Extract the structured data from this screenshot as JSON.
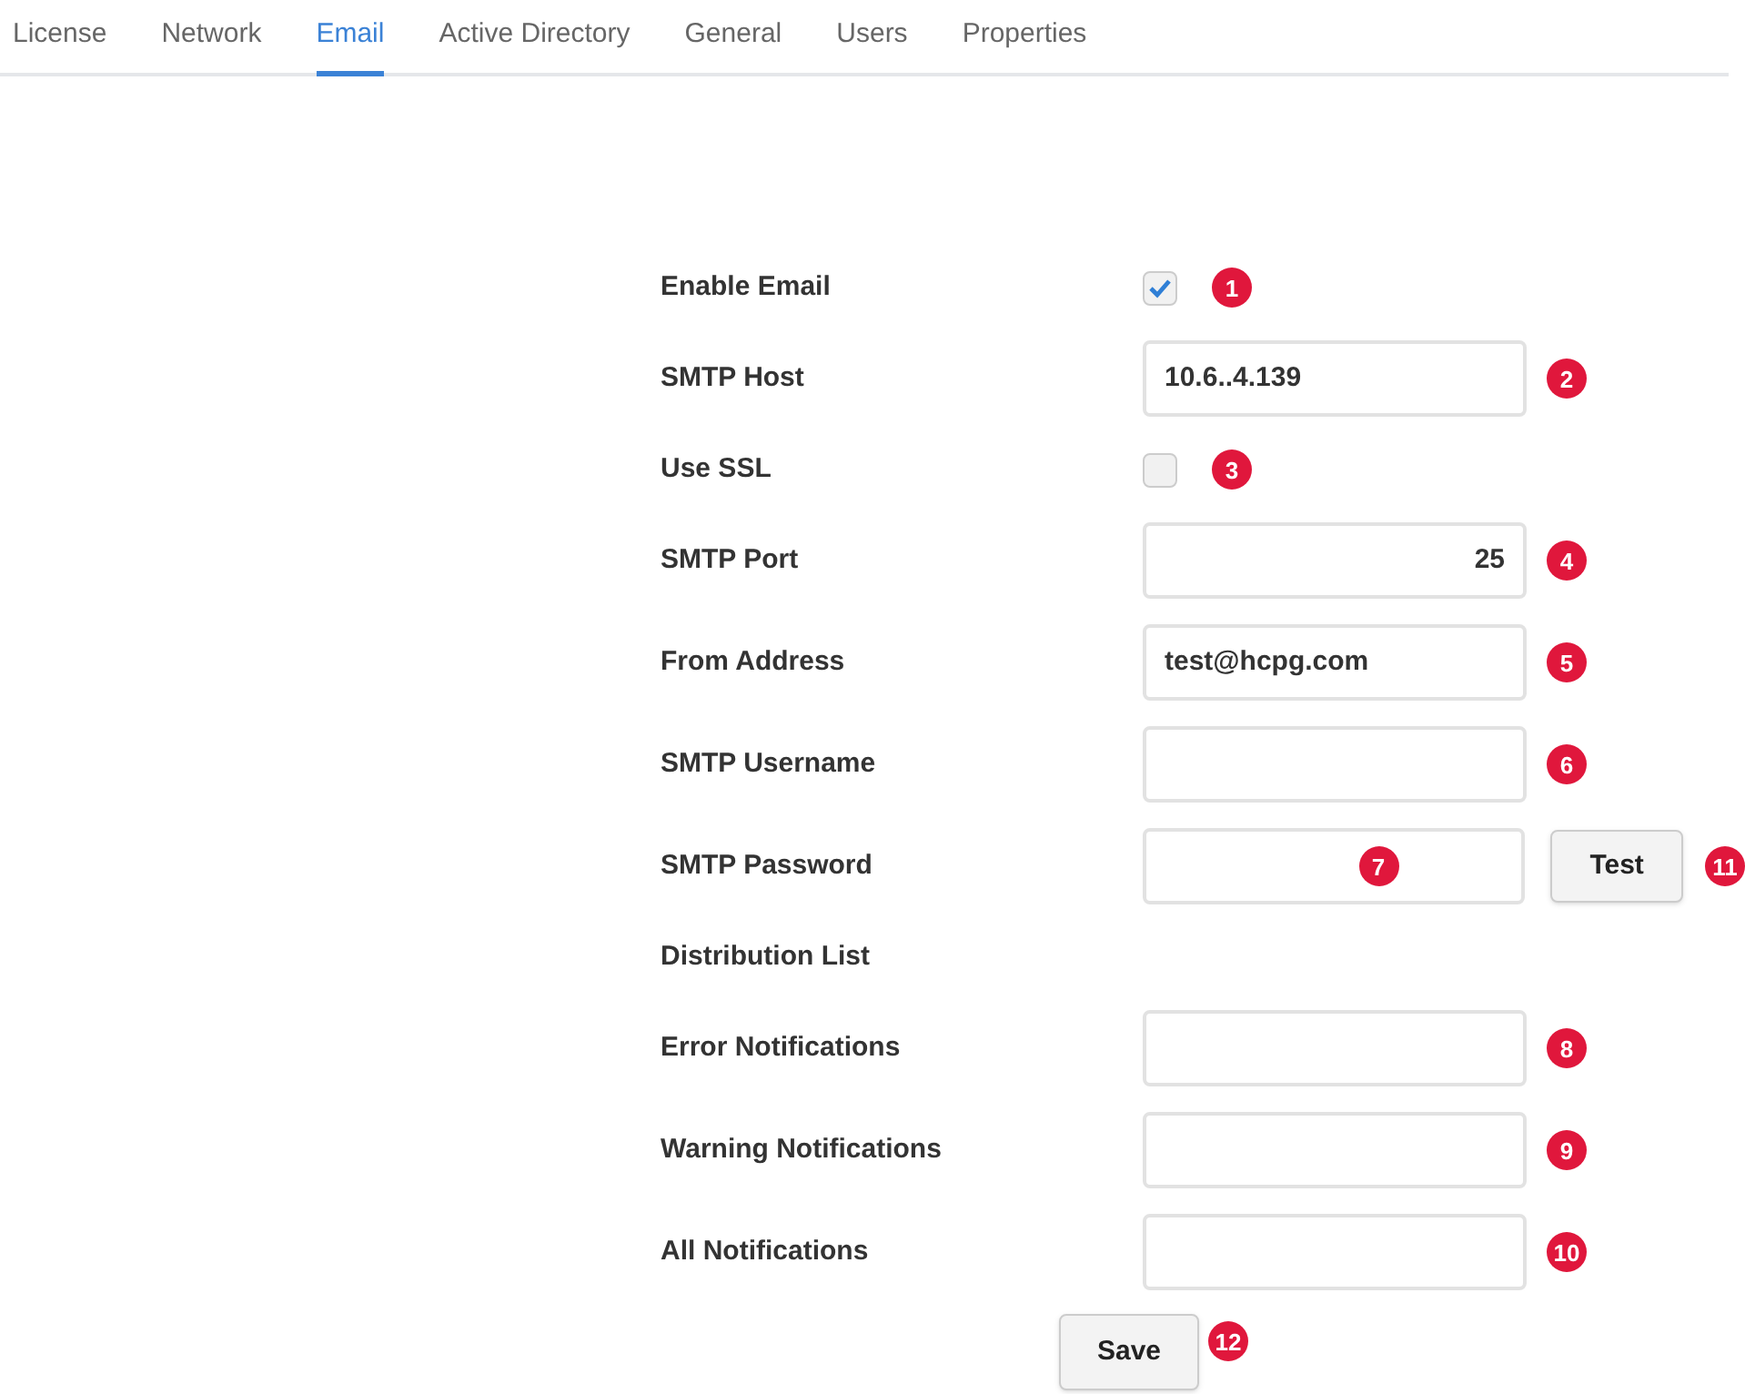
{
  "tabs": [
    {
      "label": "License",
      "selected": false
    },
    {
      "label": "Network",
      "selected": false
    },
    {
      "label": "Email",
      "selected": true
    },
    {
      "label": "Active Directory",
      "selected": false
    },
    {
      "label": "General",
      "selected": false
    },
    {
      "label": "Users",
      "selected": false
    },
    {
      "label": "Properties",
      "selected": false
    }
  ],
  "form": {
    "rows": [
      {
        "kind": "checkbox",
        "label": "Enable Email",
        "checked": true,
        "marker": "1"
      },
      {
        "kind": "text",
        "label": "SMTP Host",
        "value": "10.6..4.139",
        "marker": "2"
      },
      {
        "kind": "checkbox",
        "label": "Use SSL",
        "checked": false,
        "marker": "3"
      },
      {
        "kind": "number",
        "label": "SMTP Port",
        "value": "25",
        "marker": "4"
      },
      {
        "kind": "text",
        "label": "From Address",
        "value": "test@hcpg.com",
        "marker": "5"
      },
      {
        "kind": "text",
        "label": "SMTP Username",
        "marker": "6"
      },
      {
        "kind": "text",
        "label": "SMTP Password",
        "marker": "7",
        "marker_inside": true,
        "button": {
          "label": "Test",
          "marker": "11"
        }
      },
      {
        "kind": "heading",
        "label": "Distribution List"
      },
      {
        "kind": "text",
        "label": "Error Notifications",
        "marker": "8"
      },
      {
        "kind": "text",
        "label": "Warning Notifications",
        "marker": "9"
      },
      {
        "kind": "text",
        "label": "All Notifications",
        "marker": "10"
      }
    ],
    "save": {
      "label": "Save",
      "marker": "12"
    }
  }
}
